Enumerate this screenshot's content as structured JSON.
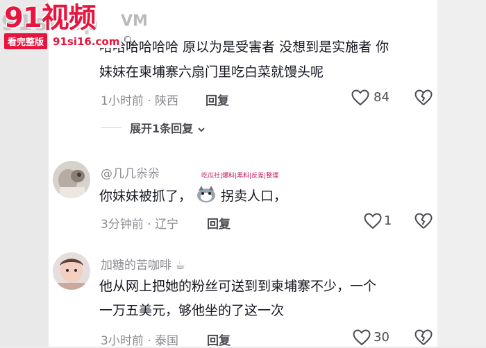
{
  "watermark": {
    "logo": "91视频",
    "ghost": "91sivip",
    "ghost2": "VM",
    "badge": "看完整版",
    "url": "91si16.com"
  },
  "comment1": {
    "lines": [
      "哈哈哈哈哈哈 原以为是受害者 没想到是实施者 你",
      "妹妹在柬埔寨六扇门里吃白菜就馒头呢"
    ],
    "time_location": "1小时前 · 陕西",
    "reply_label": "回复",
    "likes": "84",
    "expand_label": "展开1条回复"
  },
  "comment2": {
    "username": "@几几尜尜",
    "text_before": "你妹妹被抓了，",
    "text_after": "拐卖人口，",
    "time_location": "3分钟前 · 辽宁",
    "reply_label": "回复",
    "likes": "1",
    "overlay": "吃瓜社|爆料|黑料|反差|整理"
  },
  "comment3": {
    "username": "加糖的苦咖啡",
    "lines": [
      "他从网上把她的粉丝可送到到柬埔寨不少，一个",
      "一万五美元，够他坐的了这一次"
    ],
    "time_location": "3小时前 · 泰国",
    "reply_label": "回复",
    "likes": "30"
  },
  "colors": {
    "brand": "#e8143e",
    "text": "#161823",
    "meta": "#8a8b91"
  },
  "icons": [
    "heart-icon",
    "broken-heart-icon",
    "chevron-down-icon",
    "coffee-icon",
    "cat-sticker-icon",
    "cursor-icon"
  ]
}
